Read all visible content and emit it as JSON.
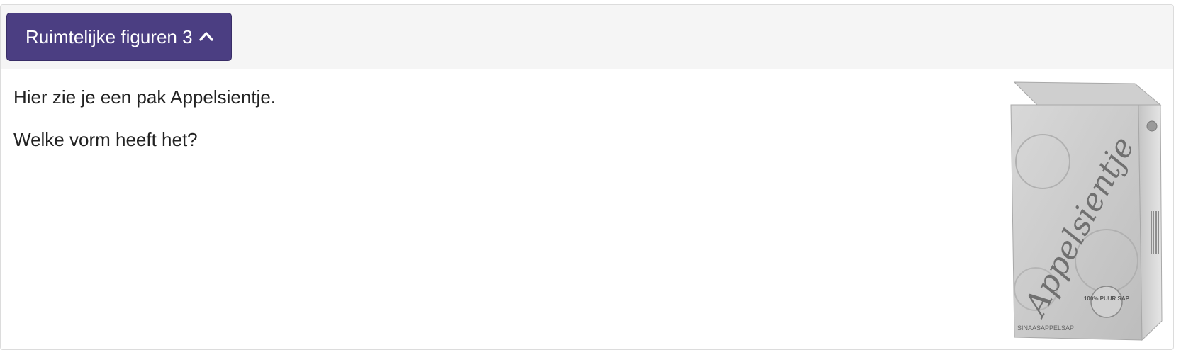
{
  "panel": {
    "toggle_label": "Ruimtelijke figuren 3",
    "toggle_icon": "chevron-up-icon",
    "accent_color": "#4b3e82"
  },
  "question": {
    "line1": "Hier zie je een pak Appelsientje.",
    "line2": "Welke vorm heeft het?"
  },
  "image": {
    "subject": "juice-carton",
    "brand_text": "Appelsientje",
    "badge_text": "100% PUUR SAP",
    "bottom_text": "SINAASAPPELSAP"
  }
}
